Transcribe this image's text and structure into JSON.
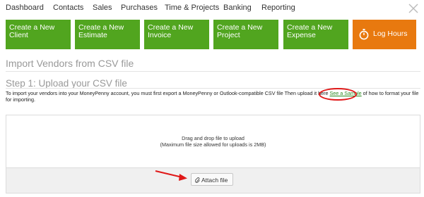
{
  "nav": {
    "items": [
      "Dashboard",
      "Contacts",
      "Sales",
      "Purchases",
      "Time & Projects",
      "Banking",
      "Reporting"
    ]
  },
  "tiles": [
    {
      "line1": "Create a New",
      "line2": "Client"
    },
    {
      "line1": "Create a New",
      "line2": "Estimate"
    },
    {
      "line1": "Create a New",
      "line2": "Invoice"
    },
    {
      "line1": "Create a New",
      "line2": "Project"
    },
    {
      "line1": "Create a New",
      "line2": "Expense"
    }
  ],
  "log_hours": {
    "label": "Log Hours",
    "icon": "stopwatch-icon"
  },
  "page": {
    "title": "Import Vendors from CSV file",
    "step_title": "Step 1: Upload your CSV file",
    "desc_before": "To import your vendors into your MoneyPenny account, you must first export a MoneyPenny or Outlook-compatible CSV file Then upload it here",
    "desc_link": "See a Sample",
    "desc_after": "of how to format your file for importing."
  },
  "upload": {
    "drop_text": "Drag and drop file to upload",
    "limit_text": "(Maximum file size allowed for uploads is 2MB)",
    "attach_label": "Attach file"
  },
  "colors": {
    "tile_green": "#51a51f",
    "tile_orange": "#e8790f",
    "link_green": "#2a8a1f",
    "annotation_red": "#e01818"
  }
}
